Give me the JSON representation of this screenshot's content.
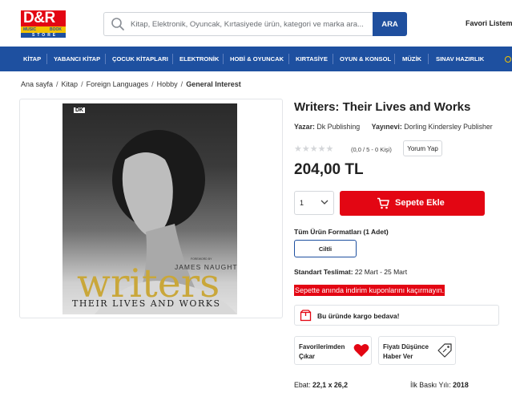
{
  "header": {
    "logo": {
      "main": "D&R",
      "left_tag": "MUSIC",
      "right_tag": "BOOK",
      "bottom": "STORE"
    },
    "search": {
      "placeholder": "Kitap, Elektronik, Oyuncak, Kırtasiyede ürün, kategori ve marka ara...",
      "button_label": "ARA"
    },
    "favorites_label": "Favori Listem"
  },
  "nav": {
    "items": [
      "KİTAP",
      "YABANCI KİTAP",
      "ÇOCUK KİTAPLARI",
      "ELEKTRONİK",
      "HOBİ & OYUNCAK",
      "KIRTASİYE",
      "OYUN & KONSOL",
      "MÜZİK",
      "SINAV HAZIRLIK"
    ]
  },
  "breadcrumb": [
    "Ana sayfa",
    "Kitap",
    "Foreign Languages",
    "Hobby",
    "General Interest"
  ],
  "cover": {
    "publisher_mark": "DK",
    "foreword": "FOREWORD BY",
    "author": "JAMES NAUGHTIE",
    "title": "writers",
    "subtitle": "THEIR LIVES AND WORKS"
  },
  "product": {
    "title": "Writers: Their Lives and Works",
    "author_label": "Yazar:",
    "author": "Dk Publishing",
    "publisher_label": "Yayınevi:",
    "publisher": "Dorling Kindersley Publisher",
    "rating_stars": "★★★★★",
    "rating_value": 0,
    "rating_text": "(0,0 / 5 - 0 Kişi)",
    "review_button": "Yorum Yap",
    "price": "204,00 TL",
    "quantity": "1",
    "add_to_cart": "Sepete Ekle",
    "formats_title": "Tüm Ürün Formatları (1 Adet)",
    "format_option": "Ciltli",
    "delivery_label": "Standart Teslimat:",
    "delivery_value": "22 Mart - 25 Mart",
    "promo": "Sepette anında indirim kuponlarını kaçırmayın.",
    "free_shipping": "Bu üründe kargo bedava!",
    "fav_add": "Favorilerimden Çıkar",
    "price_alarm": "Fiyatı Düşünce Haber Ver",
    "dimensions_label": "Ebat:",
    "dimensions": "22,1 x 26,2",
    "first_print_label": "İlk Baskı Yılı:",
    "first_print": "2018"
  },
  "colors": {
    "brand_blue": "#1e50a0",
    "cta_red": "#e30613",
    "logo_yellow": "#f2c200"
  }
}
